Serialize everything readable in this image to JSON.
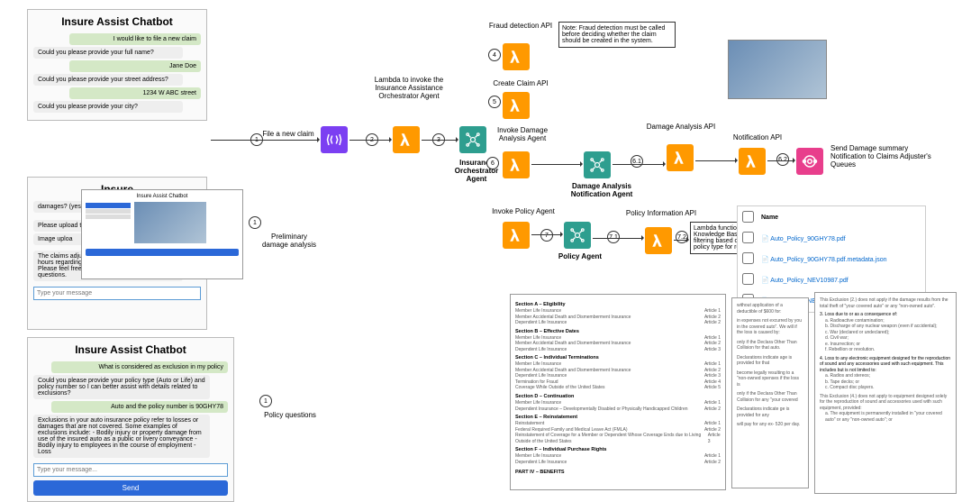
{
  "chat1": {
    "title": "Insure Assist Chatbot",
    "msgs": [
      {
        "role": "user",
        "text": "I would like to file a new claim"
      },
      {
        "role": "bot",
        "text": "Could you please provide your full name?"
      },
      {
        "role": "user",
        "text": "Jane Doe"
      },
      {
        "role": "bot",
        "text": "Could you please provide your street address?"
      },
      {
        "role": "user",
        "text": "1234 W ABC street"
      },
      {
        "role": "bot",
        "text": "Could you please provide your city?"
      }
    ]
  },
  "chat2": {
    "title": "Insure",
    "partial1": "damages? (yes",
    "partial2": "Please upload th",
    "partial3": "Image uploa",
    "tail": "The claims adjuster will contact you within 24 hours regarding your claim (ID: CLM80049). Please feel free to reach out if you have any other questions.",
    "placeholder": "Type your message"
  },
  "inner_chat_title": "Insure Assist Chatbot",
  "chat3": {
    "title": "Insure Assist Chatbot",
    "u1": "What is considered as exclusion in my policy",
    "b1": "Could you please provide your policy type (Auto or Life) and policy number so I can better assist with details related to exclusions?",
    "u2": "Auto and the policy number is 90GHY78",
    "b2": "Exclusions in your auto insurance policy refer to losses or damages that are not covered. Some examples of exclusions include: - Bodily injury or property damage from use of the insured auto as a public or livery conveyance - Bodily injury to employees in the course of employment - Loss",
    "placeholder": "Type your message...",
    "send": "Send"
  },
  "labels": {
    "file_claim": "File a new claim",
    "prelim": "Preliminary damage analysis",
    "policy_q": "Policy questions",
    "lambda_orch": "Lambda to invoke the Insurance Assistance Orchestrator Agent",
    "orch_agent": "Insurance Orchestrator Agent",
    "fraud_api": "Fraud detection API",
    "create_api": "Create Claim API",
    "invoke_dmg": "Invoke Damage Analysis Agent",
    "dmg_agent": "Damage Analysis Notification Agent",
    "dmg_api": "Damage Analysis API",
    "notif_api": "Notification API",
    "send_summary": "Send Damage summary Notification to Claims Adjuster's Queues",
    "invoke_policy": "Invoke Policy Agent",
    "policy_agent": "Policy Agent",
    "policy_info": "Policy Information API",
    "note": "Note:\nFraud detection must be called before deciding whether the claim should be created in the system.",
    "kb_note": "Lambda function invokes Bedrock Knowledge Base APIs with metadata filtering based on policy number and policy type for retrieving policy documents"
  },
  "steps": [
    "1",
    "2",
    "3",
    "4",
    "5",
    "6",
    "6.1",
    "6.2",
    "7",
    "7.1",
    "7.2"
  ],
  "files": {
    "header": "Name",
    "rows": [
      "Auto_Policy_90GHY78.pdf",
      "Auto_Policy_90GHY78.pdf.metadata.json",
      "Auto_Policy_NEV10987.pdf",
      "Auto_Policy_NEV10987.pdf.metadata.json"
    ]
  },
  "doc_left": {
    "secA": "Section A – Eligibility",
    "a_items": [
      "Member Life Insurance",
      "Member Accidental Death and Dismemberment Insurance",
      "Dependent Life Insurance"
    ],
    "a_arts": [
      "Article 1",
      "Article 2",
      "Article 2"
    ],
    "secB": "Section B – Effective Dates",
    "b_items": [
      "Member Life Insurance",
      "Member Accidental Death and Dismemberment Insurance",
      "Dependent Life Insurance"
    ],
    "b_arts": [
      "Article 1",
      "Article 2",
      "Article 3"
    ],
    "secC": "Section C – Individual Terminations",
    "c_items": [
      "Member Life Insurance",
      "Member Accidental Death and Dismemberment Insurance",
      "Dependent Life Insurance",
      "Termination for Fraud",
      "Coverage While Outside of the United States"
    ],
    "c_arts": [
      "Article 1",
      "Article 2",
      "Article 3",
      "Article 4",
      "Article 5"
    ],
    "secD": "Section D – Continuation",
    "d_items": [
      "Member Life Insurance",
      "Dependent Insurance – Developmentally Disabled or Physically Handicapped Children"
    ],
    "d_arts": [
      "Article 1",
      "Article 2"
    ],
    "secE": "Section E – Reinstatement",
    "e_items": [
      "Reinstatement",
      "Federal Required Family and Medical Leave Act (FMLA)",
      "Reinstatement of Coverage for a Member or Dependent Whose Coverage Ends due to Living Outside of the United States"
    ],
    "e_arts": [
      "Article 1",
      "Article 2",
      "Article 3"
    ],
    "secF": "Section F – Individual Purchase Rights",
    "f_items": [
      "Member Life Insurance",
      "Dependent Life Insurance"
    ],
    "f_arts": [
      "Article 1",
      "Article 2"
    ],
    "part4": "PART IV – BENEFITS"
  },
  "doc_mid": {
    "l1": "without application of a deductible of $600 for:",
    "l2": "in expenses not excurred by you in the covered auto\". We will if the loss is caused by:",
    "l3": "only if the Declara Other Than Collision for that auto.",
    "l4": "Declarations indicate age is provided for that",
    "l5": "become legally resulting to a \"non-owned xpenses if the loss is",
    "l6": "only if the Declara Other Than Collision for any \"your covered",
    "l7": "Declarations indicate ge is provided for any",
    "l8": "will pay for any ex- 520 per day."
  },
  "doc_right": {
    "p1": "This Exclusion (2.) does not apply if the damage results from the total theft of \"your covered auto\" or any \"non-owned auto\".",
    "h3": "3. Loss due to or as a consequence of:",
    "a": "a. Radioactive contamination;",
    "b": "b. Discharge of any nuclear weapon (even if accidental);",
    "c": "c. War (declared or undeclared);",
    "d": "d. Civil war;",
    "e": "e. Insurrection; or",
    "f": "f. Rebellion or revolution.",
    "h4": "4. Loss to any electronic equipment designed for the reproduction of sound and any accessories used with such equipment. This includes but is not limited to:",
    "a4": "a. Radios and stereos;",
    "b4": "b. Tape decks; or",
    "c4": "c. Compact disc players.",
    "p2": "This Exclusion (4.) does not apply to equipment designed solely for the reproduction of sound and accessories used with such equipment, provided:",
    "a5": "a. The equipment is permanently installed in \"your covered auto\" or any \"non-owned auto\"; or"
  }
}
